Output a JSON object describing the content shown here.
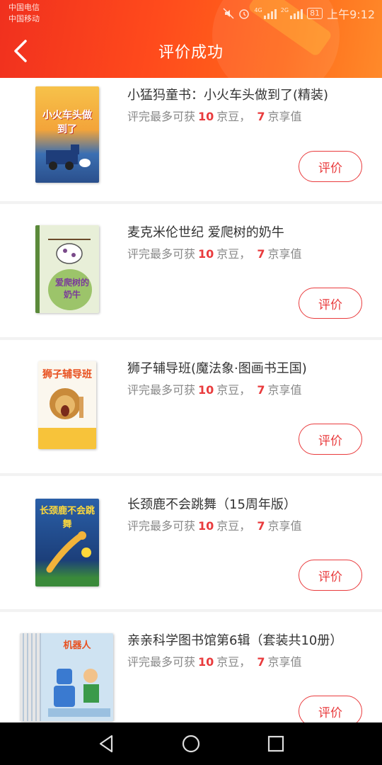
{
  "status_bar": {
    "carrier_1": "中国电信",
    "carrier_2": "中国移动",
    "signal_1_label": "4G",
    "signal_2_label": "2G",
    "battery": "81",
    "time": "上午9:12"
  },
  "header": {
    "title": "评价成功",
    "background_color": "#f0301e"
  },
  "reward_template": {
    "prefix": "评完最多可获",
    "beans_unit": "京豆，",
    "points_unit": "京享值"
  },
  "products": [
    {
      "name": "小猛犸童书：小火车头做到了(精装)",
      "beans": "10",
      "points": "7",
      "button": "评价",
      "cover_text": "小火车头做到了",
      "cover_icon": "train-book-cover"
    },
    {
      "name": "麦克米伦世纪 爱爬树的奶牛",
      "beans": "10",
      "points": "7",
      "button": "评价",
      "cover_text": "爱爬树的奶牛",
      "cover_icon": "cow-book-cover"
    },
    {
      "name": "狮子辅导班(魔法象·图画书王国)",
      "beans": "10",
      "points": "7",
      "button": "评价",
      "cover_text": "狮子辅导班",
      "cover_icon": "lion-book-cover"
    },
    {
      "name": "长颈鹿不会跳舞（15周年版）",
      "beans": "10",
      "points": "7",
      "button": "评价",
      "cover_text": "长颈鹿不会跳舞",
      "cover_icon": "giraffe-book-cover"
    },
    {
      "name": "亲亲科学图书馆第6辑（套装共10册）",
      "beans": "10",
      "points": "7",
      "button": "评价",
      "cover_text": "机器人",
      "cover_icon": "robot-book-cover"
    }
  ],
  "accent_color": "#e93b3d",
  "system_nav": {
    "back": "back-triangle-icon",
    "home": "home-circle-icon",
    "recents": "recents-square-icon"
  }
}
